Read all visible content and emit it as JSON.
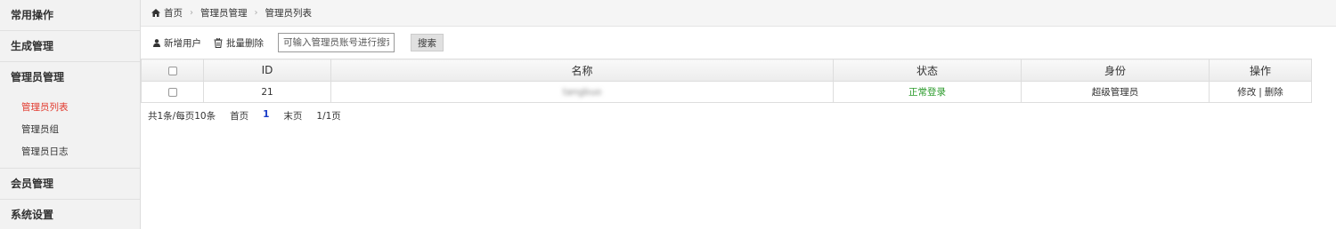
{
  "sidebar": {
    "groups": [
      {
        "label": "常用操作"
      },
      {
        "label": "生成管理"
      },
      {
        "label": "管理员管理",
        "items": [
          {
            "label": "管理员列表",
            "active": true
          },
          {
            "label": "管理员组"
          },
          {
            "label": "管理员日志"
          }
        ]
      },
      {
        "label": "会员管理"
      },
      {
        "label": "系统设置"
      }
    ]
  },
  "breadcrumb": {
    "home_icon": "home-icon",
    "items": [
      "首页",
      "管理员管理",
      "管理员列表"
    ]
  },
  "toolbar": {
    "add_label": "新增用户",
    "add_icon": "user-icon",
    "delete_label": "批量删除",
    "delete_icon": "trash-icon",
    "search_placeholder": "可输入管理员账号进行搜索",
    "search_button": "搜索"
  },
  "table": {
    "headers": [
      "",
      "ID",
      "名称",
      "状态",
      "身份",
      "操作"
    ],
    "rows": [
      {
        "id": "21",
        "name": "tangbuo",
        "status": "正常登录",
        "role": "超级管理员",
        "edit": "修改",
        "sep": "|",
        "delete": "删除"
      }
    ]
  },
  "pager": {
    "summary": "共1条/每页10条",
    "first": "首页",
    "current": "1",
    "last": "末页",
    "pages": "1/1页"
  },
  "colors": {
    "active_link": "#e23a2e",
    "status_ok": "#2a9a2a",
    "pager_current": "#1a3cc8"
  }
}
